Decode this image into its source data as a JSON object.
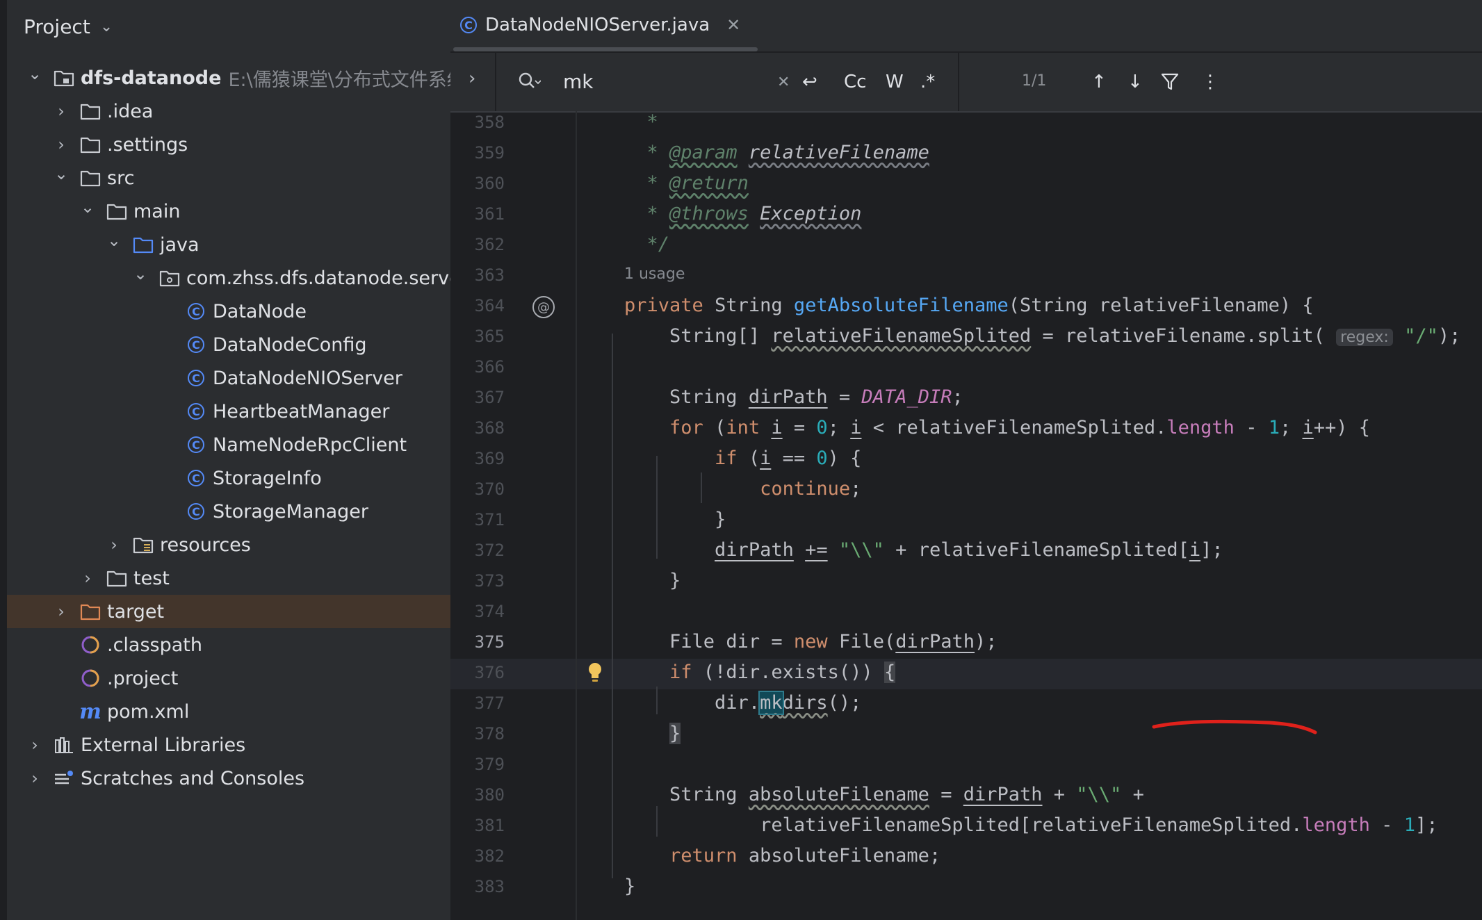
{
  "project": {
    "title": "Project",
    "tree": [
      {
        "label": "dfs-datanode",
        "path": "E:\\儒猿课堂\\分布式文件系统\\",
        "icon": "module-folder-icon",
        "arrow": "expanded",
        "bold": true
      },
      {
        "label": ".idea",
        "icon": "folder-icon",
        "arrow": "collapsed"
      },
      {
        "label": ".settings",
        "icon": "folder-icon",
        "arrow": "collapsed"
      },
      {
        "label": "src",
        "icon": "folder-icon",
        "arrow": "expanded"
      },
      {
        "label": "main",
        "icon": "folder-icon",
        "arrow": "expanded"
      },
      {
        "label": "java",
        "icon": "source-folder-icon",
        "arrow": "expanded"
      },
      {
        "label": "com.zhss.dfs.datanode.server",
        "icon": "package-icon",
        "arrow": "expanded"
      },
      {
        "label": "DataNode",
        "icon": "class-icon"
      },
      {
        "label": "DataNodeConfig",
        "icon": "class-icon"
      },
      {
        "label": "DataNodeNIOServer",
        "icon": "class-icon"
      },
      {
        "label": "HeartbeatManager",
        "icon": "class-icon"
      },
      {
        "label": "NameNodeRpcClient",
        "icon": "class-icon"
      },
      {
        "label": "StorageInfo",
        "icon": "class-icon"
      },
      {
        "label": "StorageManager",
        "icon": "class-icon"
      },
      {
        "label": "resources",
        "icon": "resources-folder-icon",
        "arrow": "collapsed"
      },
      {
        "label": "test",
        "icon": "folder-icon",
        "arrow": "collapsed"
      },
      {
        "label": "target",
        "icon": "excluded-folder-icon",
        "arrow": "collapsed",
        "selected": true
      },
      {
        "label": ".classpath",
        "icon": "eclipse-file-icon"
      },
      {
        "label": ".project",
        "icon": "eclipse-file-icon"
      },
      {
        "label": "pom.xml",
        "icon": "maven-icon"
      },
      {
        "label": "External Libraries",
        "icon": "library-icon",
        "arrow": "collapsed"
      },
      {
        "label": "Scratches and Consoles",
        "icon": "scratches-icon",
        "arrow": "collapsed"
      }
    ]
  },
  "editor": {
    "tab_label": "DataNodeNIOServer.java",
    "find": {
      "query": "mk",
      "count": "1/1",
      "case_label": "Cc",
      "word_label": "W",
      "regex_label": ".*"
    },
    "usage_hint": "1 usage",
    "param_hint": "regex:",
    "lines": [
      "358",
      "359",
      "360",
      "361",
      "362",
      "363",
      "364",
      "365",
      "366",
      "367",
      "368",
      "369",
      "370",
      "371",
      "372",
      "373",
      "374",
      "375",
      "376",
      "377",
      "378",
      "379",
      "380",
      "381",
      "382",
      "383"
    ],
    "current_line": "375",
    "code": {
      "l358": "*",
      "l359_tag": "@param",
      "l359_ref": "relativeFilename",
      "l360_tag": "@return",
      "l361_tag": "@throws",
      "l361_ref": "Exception",
      "l362": "*/",
      "private": "private",
      "String": "String",
      "getAbsoluteFilename": "getAbsoluteFilename",
      "relativeFilename": "relativeFilename",
      "relativeFilenameSplited": "relativeFilenameSplited",
      "split": "split",
      "slash": "\"/\"",
      "dirPath": "dirPath",
      "DATA_DIR": "DATA_DIR",
      "for": "for",
      "int": "int",
      "i": "i",
      "zero": "0",
      "one": "1",
      "length": "length",
      "if": "if",
      "continue": "continue",
      "backslash": "\"\\\\\"",
      "File": "File",
      "dir": "dir",
      "new": "new",
      "exists": "exists",
      "mk": "mk",
      "dirs": "dirs",
      "absoluteFilename": "absoluteFilename",
      "return": "return"
    }
  }
}
